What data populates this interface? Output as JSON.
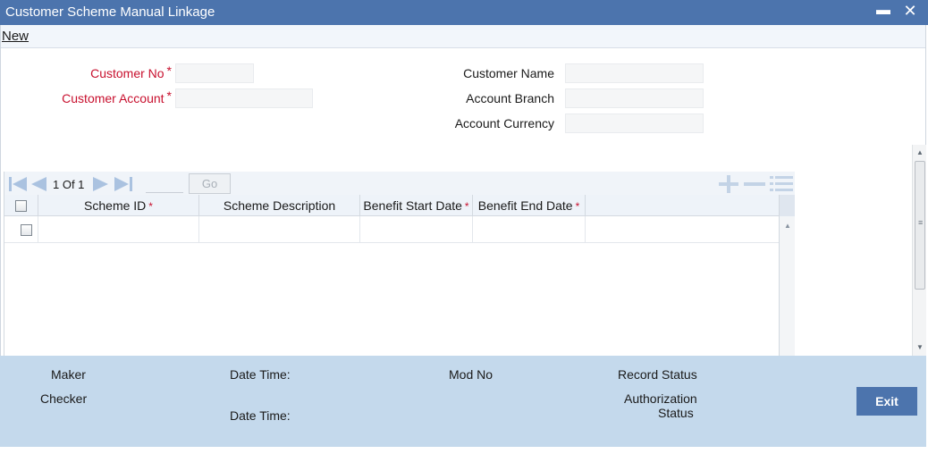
{
  "window": {
    "title": "Customer Scheme Manual Linkage",
    "minimize_glyph": "▬",
    "close_glyph": "✕"
  },
  "menu": {
    "new_label": "New"
  },
  "form": {
    "customer_no": {
      "label": "Customer No",
      "required_mark": "*",
      "value": ""
    },
    "customer_account": {
      "label": "Customer Account",
      "required_mark": "*",
      "value": ""
    },
    "customer_name": {
      "label": "Customer Name",
      "value": ""
    },
    "account_branch": {
      "label": "Account Branch",
      "value": ""
    },
    "account_currency": {
      "label": "Account Currency",
      "value": ""
    }
  },
  "grid": {
    "pagination": {
      "page_text": "1 Of 1",
      "page_input": "",
      "go_label": "Go"
    },
    "icons": [
      "first-page-icon",
      "previous-page-icon",
      "next-page-icon",
      "last-page-icon",
      "add-row-icon",
      "delete-row-icon",
      "single-view-icon"
    ],
    "columns": [
      {
        "label": "Scheme ID",
        "required_mark": "*"
      },
      {
        "label": "Scheme Description",
        "required_mark": ""
      },
      {
        "label": "Benefit Start Date",
        "required_mark": "*"
      },
      {
        "label": "Benefit End Date",
        "required_mark": "*"
      }
    ],
    "rows": [
      {
        "scheme_id": "",
        "scheme_description": "",
        "benefit_start_date": "",
        "benefit_end_date": ""
      }
    ]
  },
  "footer": {
    "maker": "Maker",
    "checker": "Checker",
    "date_time_1": "Date Time:",
    "date_time_2": "Date Time:",
    "mod_no": "Mod No",
    "record_status": "Record Status",
    "authorization_status_line1": "Authorization",
    "authorization_status_line2": "Status",
    "exit_label": "Exit"
  },
  "colors": {
    "title_bar": "#4c74ad",
    "required_label": "#c8102e",
    "footer_bg": "#c4d9ec",
    "exit_button": "#4c74ad"
  }
}
